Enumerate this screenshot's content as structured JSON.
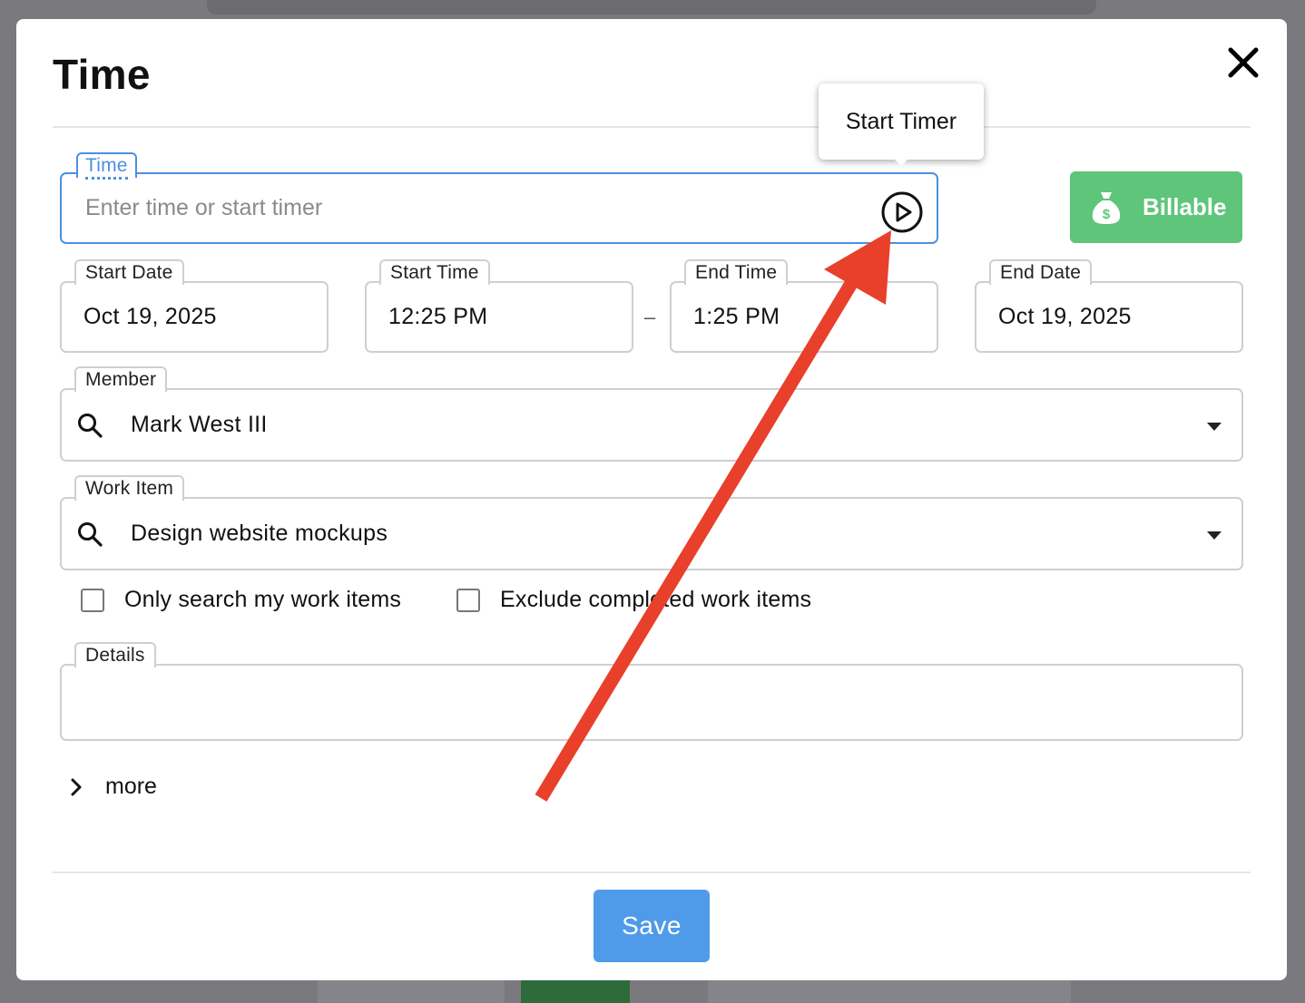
{
  "modal": {
    "title": "Time",
    "close_icon": "close-icon",
    "save_label": "Save"
  },
  "time_field": {
    "label": "Time",
    "placeholder": "Enter time or start timer",
    "play_icon": "play-circle-icon",
    "tooltip": "Start Timer"
  },
  "billable": {
    "label": "Billable",
    "icon": "money-bag-icon",
    "color": "#5ec57a"
  },
  "dates": {
    "start_date_label": "Start Date",
    "start_date": "Oct 19, 2025",
    "start_time_label": "Start Time",
    "start_time": "12:25 PM",
    "separator": "–",
    "end_time_label": "End Time",
    "end_time": "1:25 PM",
    "end_date_label": "End Date",
    "end_date": "Oct 19, 2025"
  },
  "member": {
    "label": "Member",
    "value": "Mark West III"
  },
  "work_item": {
    "label": "Work Item",
    "value": "Design website mockups"
  },
  "filters": {
    "only_mine": "Only search my work items",
    "exclude_completed": "Exclude completed work items"
  },
  "details": {
    "label": "Details",
    "value": ""
  },
  "more_label": "more",
  "colors": {
    "accent": "#4a90e2",
    "save": "#4f9be9",
    "annotation": "#e8402a"
  }
}
